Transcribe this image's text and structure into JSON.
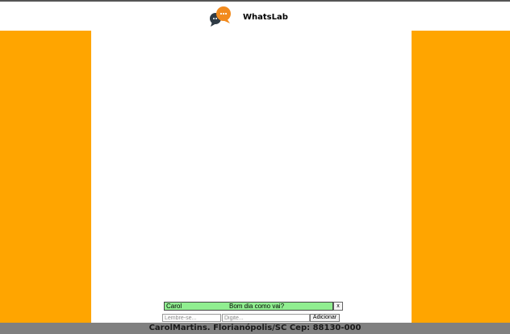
{
  "header": {
    "title": "WhatsLab",
    "logo_icon": "chat-bubbles-icon"
  },
  "colors": {
    "side_panel": "#ffa500",
    "message_background": "#90ee90",
    "footer": "#808080"
  },
  "messages": [
    {
      "sender": "Carol",
      "text": "Bom dia como vai?",
      "delete_label": "x"
    }
  ],
  "form": {
    "name_placeholder": "Lembre-se...",
    "message_placeholder": "Digite...",
    "add_label": "Adicionar"
  },
  "footer": {
    "text": "CarolMartins. Florianópolis/SC Cep: 88130-000"
  }
}
